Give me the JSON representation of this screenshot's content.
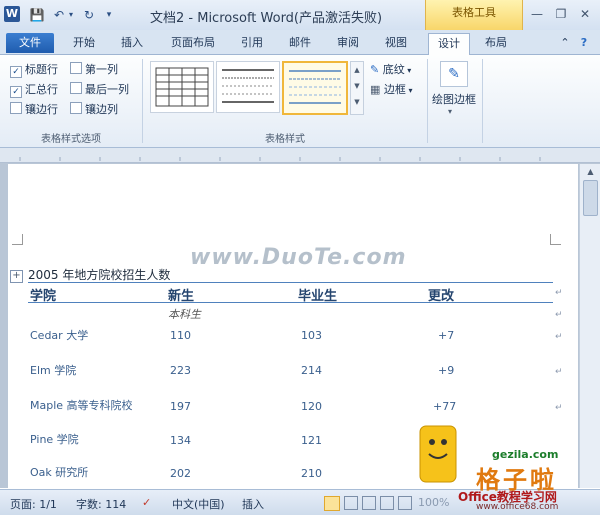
{
  "window": {
    "title": "文档2 - Microsoft Word(产品激活失败)",
    "contextual_tab": "表格工具",
    "app_icon_letter": "W"
  },
  "quick_access": [
    "save-icon",
    "undo-icon",
    "dropdown-icon",
    "redo-icon",
    "customize-icon"
  ],
  "tabs": [
    {
      "label": "文件"
    },
    {
      "label": "开始"
    },
    {
      "label": "插入"
    },
    {
      "label": "页面布局"
    },
    {
      "label": "引用"
    },
    {
      "label": "邮件"
    },
    {
      "label": "审阅"
    },
    {
      "label": "视图"
    },
    {
      "label": "设计"
    },
    {
      "label": "布局"
    }
  ],
  "active_tab": "设计",
  "ribbon": {
    "options_group": {
      "label": "表格样式选项",
      "checks": [
        {
          "label": "标题行",
          "checked": true
        },
        {
          "label": "第一列",
          "checked": false
        },
        {
          "label": "汇总行",
          "checked": true
        },
        {
          "label": "最后一列",
          "checked": false
        },
        {
          "label": "镶边行",
          "checked": false
        },
        {
          "label": "镶边列",
          "checked": false
        }
      ]
    },
    "styles_group": {
      "label": "表格样式",
      "shading_label": "底纹",
      "borders_label": "边框"
    },
    "draw_group": {
      "label": "绘图边框"
    }
  },
  "document": {
    "heading": "2005 年地方院校招生人数",
    "columns": [
      "学院",
      "新生",
      "毕业生",
      "更改"
    ],
    "subheader": "本科生",
    "rows": [
      [
        "Cedar 大学",
        "110",
        "103",
        "+7"
      ],
      [
        "Elm 学院",
        "223",
        "214",
        "+9"
      ],
      [
        "Maple 高等专科院校",
        "197",
        "120",
        "+77"
      ],
      [
        "Pine 学院",
        "134",
        "121",
        ""
      ],
      [
        "Oak 研究所",
        "202",
        "210",
        ""
      ]
    ]
  },
  "status_bar": {
    "page": "页面: 1/1",
    "words": "字数: 114",
    "language": "中文(中国)",
    "mode": "插入",
    "zoom": "100%"
  },
  "watermarks": {
    "duote": "www.DuoTe.com",
    "gezila": "gezila.com",
    "gzw": "格子啦",
    "office": "Office教程学习网",
    "office_url": "www.office68.com"
  },
  "colors": {
    "accent": "#2b5797",
    "contextual": "#f8d66a",
    "selected_style": "#f0b73b"
  }
}
